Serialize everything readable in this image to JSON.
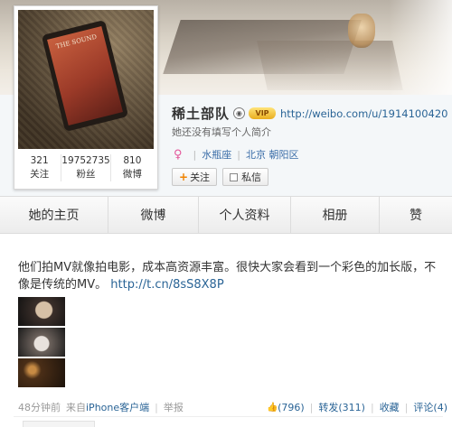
{
  "profile": {
    "name": "稀土部队",
    "vip_label": "VIP",
    "url": "http://weibo.com/u/1914100420",
    "intro": "她还没有填写个人简介",
    "tags": [
      "水瓶座",
      "北京 朝阳区"
    ],
    "avatar_book_title": "THE SOUND",
    "stats": [
      {
        "value": "321",
        "label": "关注"
      },
      {
        "value": "19752735",
        "label": "粉丝"
      },
      {
        "value": "810",
        "label": "微博"
      }
    ],
    "actions": {
      "follow": "关注",
      "message": "私信"
    }
  },
  "tabs": [
    "她的主页",
    "微博",
    "个人资料",
    "相册",
    "赞"
  ],
  "post": {
    "text": "他们拍MV就像拍电影，成本高资源丰富。很快大家会看到一个彩色的加长版，不像是传统的MV。",
    "link": "http://t.cn/8sS8X8P",
    "time": "48分钟前",
    "source_prefix": "来自",
    "source_app": "iPhone客户端",
    "report": "举报",
    "likes": "(796)",
    "repost": "转发(311)",
    "favorite": "收藏",
    "comment": "评论(4)"
  },
  "colors": {
    "link": "#2a6496",
    "accent": "#f08300"
  }
}
